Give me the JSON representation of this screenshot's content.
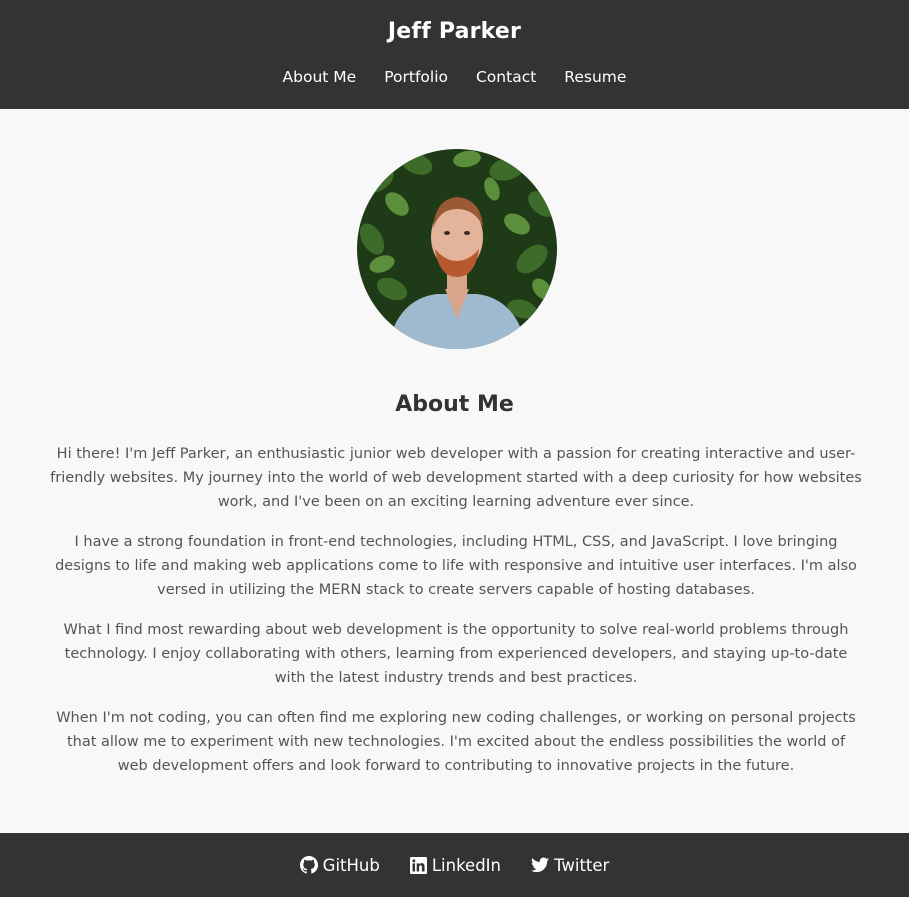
{
  "header": {
    "title": "Jeff Parker",
    "nav": [
      "About Me",
      "Portfolio",
      "Contact",
      "Resume"
    ]
  },
  "about": {
    "heading": "About Me",
    "paragraphs": [
      "Hi there! I'm Jeff Parker, an enthusiastic junior web developer with a passion for creating interactive and user-friendly websites. My journey into the world of web development started with a deep curiosity for how websites work, and I've been on an exciting learning adventure ever since.",
      "I have a strong foundation in front-end technologies, including HTML, CSS, and JavaScript. I love bringing designs to life and making web applications come to life with responsive and intuitive user interfaces. I'm also versed in utilizing the MERN stack to create servers capable of hosting databases.",
      "What I find most rewarding about web development is the opportunity to solve real-world problems through technology. I enjoy collaborating with others, learning from experienced developers, and staying up-to-date with the latest industry trends and best practices.",
      "When I'm not coding, you can often find me exploring new coding challenges, or working on personal projects that allow me to experiment with new technologies. I'm excited about the endless possibilities the world of web development offers and look forward to contributing to innovative projects in the future."
    ]
  },
  "footer": {
    "links": [
      {
        "label": "GitHub",
        "icon": "github-icon"
      },
      {
        "label": "LinkedIn",
        "icon": "linkedin-icon"
      },
      {
        "label": "Twitter",
        "icon": "twitter-icon"
      }
    ]
  },
  "colors": {
    "header_bg": "#333333",
    "page_bg": "#f8f8f8",
    "heading": "#333333",
    "body_text": "#555555"
  }
}
